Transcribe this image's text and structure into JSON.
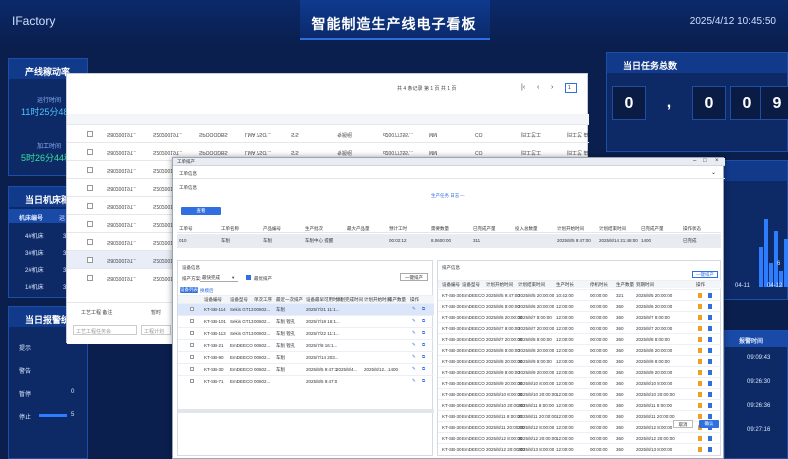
{
  "header": {
    "brand": "IFactory",
    "title": "智能制造生产线电子看板",
    "clock": "2025/4/12 10:45:50"
  },
  "left": {
    "rate_title": "产线稼动率",
    "run_label": "运行时间",
    "run_value": "11时25分48秒",
    "work_label": "加工时间",
    "work_value": "5时26分44秒",
    "machine_title": "当日机床稼动",
    "col1": "机床编号",
    "col2": "运",
    "rows": [
      {
        "id": "4#机床",
        "v": "3时"
      },
      {
        "id": "3#机床",
        "v": "3时"
      },
      {
        "id": "2#机床",
        "v": "3时"
      },
      {
        "id": "1#机床",
        "v": "3时"
      }
    ],
    "alarm_title": "当日报警统计",
    "alarm_rows": [
      {
        "k": "提示",
        "v": ""
      },
      {
        "k": "警告",
        "v": ""
      },
      {
        "k": "暂停",
        "v": "0"
      },
      {
        "k": "停止",
        "v": "5"
      }
    ]
  },
  "right": {
    "task_title": "当日任务总数",
    "digits": [
      "0",
      ",",
      "0",
      "0",
      "9"
    ],
    "output_title": "累计产量总数",
    "chart_value": "6",
    "chart_x": [
      "04-11",
      "04-12"
    ],
    "alarm_header": "报警时间",
    "alarm_times": [
      "09:09:43",
      "09:26:30",
      "09:26:36",
      "09:27:16"
    ],
    "chart_bars": [
      0.5,
      0.85,
      0.3,
      0.7,
      0.2,
      0.6
    ]
  },
  "back": {
    "pager": "共 4 条记录 第 1 页 共 1 页",
    "page_input": "1",
    "toolbar_btn": "筛选",
    "rows": [
      {
        "c1": "S8020019T...",
        "c2": "S2020019T...",
        "c3": "SPOOODBS",
        "c4": "LMA 7SO'...",
        "c5": "S'S",
        "c6": "专题组",
        "c7": "d20077155'...",
        "c8": "MM",
        "c9": "CO",
        "c10": "旧工艺工",
        "c11": "旧工艺 由"
      },
      {
        "c1": "S8020019T...",
        "c2": "S2020019T...",
        "c3": "SPOOODBS",
        "c4": "LMA 7SO'...",
        "c5": "S'S",
        "c6": "专题组",
        "c7": "d20077155'...",
        "c8": "MM",
        "c9": "CO",
        "c10": "旧工艺工",
        "c11": "旧工艺 由"
      },
      {
        "c1": "S8020019T...",
        "c2": "S2020019T...",
        "c3": "",
        "c4": "",
        "c5": "",
        "c6": "",
        "c7": "",
        "c8": "",
        "c9": "",
        "c10": "",
        "c11": ""
      },
      {
        "c1": "S8020019T...",
        "c2": "S2020019T...",
        "c3": "",
        "c4": "",
        "c5": "",
        "c6": "",
        "c7": "",
        "c8": "",
        "c9": "",
        "c10": "",
        "c11": ""
      },
      {
        "c1": "S8020019T...",
        "c2": "S2020019T...",
        "c3": "",
        "c4": "",
        "c5": "",
        "c6": "",
        "c7": "",
        "c8": "",
        "c9": "",
        "c10": "",
        "c11": ""
      },
      {
        "c1": "S8020019T...",
        "c2": "S2020019T...",
        "c3": "",
        "c4": "",
        "c5": "",
        "c6": "",
        "c7": "",
        "c8": "",
        "c9": "",
        "c10": "",
        "c11": ""
      },
      {
        "c1": "S8020019T...",
        "c2": "S2020019T...",
        "c3": "",
        "c4": "",
        "c5": "",
        "c6": "",
        "c7": "",
        "c8": "",
        "c9": "",
        "c10": "",
        "c11": ""
      },
      {
        "c1": "S8020019T...",
        "c2": "S2020019T...",
        "c3": "",
        "c4": "",
        "c5": "",
        "c6": "",
        "c7": "",
        "c8": "",
        "c9": "",
        "c10": "",
        "c11": ""
      },
      {
        "c1": "S8020019T...",
        "c2": "S2020019T...",
        "c3": "",
        "c4": "",
        "c5": "",
        "c6": "",
        "c7": "",
        "c8": "",
        "c9": "",
        "c10": "",
        "c11": ""
      }
    ],
    "footer_a": "工艺工程任务会",
    "footer_b": "工程计划",
    "footer_c": "工艺工程 备注",
    "footer_d": "暂时"
  },
  "modal": {
    "title": "工单排产",
    "tab": "工单信息",
    "sec1": "工单信息",
    "sec1_btn": "生产任务 日志",
    "btn_view": "查看",
    "wo_headers": [
      "工单号",
      "工单名称",
      "产品编号",
      "生产批次",
      "最大产品量",
      "预计工时",
      "需要数量",
      "已完成产量",
      "投入总数量",
      "计划开始时间",
      "计划结束时间",
      "已完成产量",
      "操作状态"
    ],
    "wo_row": [
      "010",
      "车削",
      "车削",
      "车削中心 提醒",
      "",
      "00:02:12",
      "8.0600:00",
      "311",
      "",
      "2025/8/5 9:47:00",
      "2025/8/14 21:48:00",
      "1400",
      "已完成"
    ],
    "dev_title": "设备信息",
    "filter_label": "排产方案:",
    "filter_value": "最快完成",
    "filter_check": "最优排产",
    "dev_btn": "一键排产",
    "dev_tabs": [
      "设备列表",
      "换模后"
    ],
    "dev_headers": [
      "",
      "设备编号",
      "设备型号",
      "单次工序",
      "最近一次排产",
      "设备最早可用时间",
      "计划完成时间",
      "计划开始时间",
      "排产数量",
      "操作"
    ],
    "dev_rows": [
      {
        "a": "KT-SB-114",
        "b": "Sekis GT13",
        "c": "00602...",
        "d": "车削",
        "e": "2025/7/21 11:1...",
        "f": "",
        "g": "",
        "h": ""
      },
      {
        "a": "KT-SB-101",
        "b": "Sekis GT13",
        "c": "00602...",
        "d": "车削 镗孔",
        "e": "2025/7/18 16:1...",
        "f": "",
        "g": "",
        "h": ""
      },
      {
        "a": "KT-SB-113",
        "b": "Sekis GT13",
        "c": "00602...",
        "d": "车削 镗孔",
        "e": "2025/7/22 11:1...",
        "f": "",
        "g": "",
        "h": ""
      },
      {
        "a": "KT-SB-21",
        "b": "EmDEECO",
        "c": "00602...",
        "d": "车削 镗孔",
        "e": "2025/7/8 16:1...",
        "f": "",
        "g": "",
        "h": ""
      },
      {
        "a": "KT-SB-90",
        "b": "EmDEECO",
        "c": "00602...",
        "d": "车削",
        "e": "2025/7/14 203...",
        "f": "",
        "g": "",
        "h": ""
      },
      {
        "a": "KT-SB-30",
        "b": "EmDEECO",
        "c": "00602...",
        "d": "车削",
        "e": "2025/8/5 9:47:1",
        "f": "2025/8/4...",
        "g": "2025/8/12...",
        "h": "1400"
      },
      {
        "a": "KT-SB-71",
        "b": "EmDEECO",
        "c": "00602...",
        "d": "",
        "e": "2025/8/5 9:47:0",
        "f": "",
        "g": "",
        "h": ""
      }
    ],
    "sched_title": "排产信息",
    "sched_btn": "一键排产",
    "sched_headers": [
      "设备编号",
      "设备型号",
      "计划开始时间",
      "计划结束时间",
      "生产时长",
      "停机时长",
      "生产数量",
      "到期时间",
      "操作"
    ],
    "sched_rows": [
      {
        "a": "KT-SB-30",
        "b": "EmDEECO",
        "c": "2025/8/5 9:47:00",
        "d": "2025/8/5 20:00:00",
        "e": "10:42:00",
        "f": "00:00:00",
        "g": "321",
        "h": "2025/8/5 20:00:00"
      },
      {
        "a": "KT-SB-30",
        "b": "EmDEECO",
        "c": "2025/8/6 8:00:00",
        "d": "2025/8/6 20:00:00",
        "e": "12:00:00",
        "f": "00:00:00",
        "g": "360",
        "h": "2025/8/6 20:00:00"
      },
      {
        "a": "KT-SB-30",
        "b": "EmDEECO",
        "c": "2025/8/6 20:00:00",
        "d": "2025/8/7 8:00:00",
        "e": "12:00:00",
        "f": "00:00:00",
        "g": "360",
        "h": "2025/8/7 8:00:00"
      },
      {
        "a": "KT-SB-30",
        "b": "EmDEECO",
        "c": "2025/8/7 8:00:00",
        "d": "2025/8/7 20:00:00",
        "e": "12:00:00",
        "f": "00:00:00",
        "g": "360",
        "h": "2025/8/7 20:00:00"
      },
      {
        "a": "KT-SB-30",
        "b": "EmDEECO",
        "c": "2025/8/7 20:00:00",
        "d": "2025/8/8 8:00:00",
        "e": "12:00:00",
        "f": "00:00:00",
        "g": "360",
        "h": "2025/8/8 8:00:00"
      },
      {
        "a": "KT-SB-30",
        "b": "EmDEECO",
        "c": "2025/8/8 8:00:00",
        "d": "2025/8/8 20:00:00",
        "e": "12:00:00",
        "f": "00:00:00",
        "g": "360",
        "h": "2025/8/8 20:00:00"
      },
      {
        "a": "KT-SB-30",
        "b": "EmDEECO",
        "c": "2025/8/8 20:00:00",
        "d": "2025/8/9 8:00:00",
        "e": "12:00:00",
        "f": "00:00:00",
        "g": "360",
        "h": "2025/8/9 8:00:00"
      },
      {
        "a": "KT-SB-30",
        "b": "EmDEECO",
        "c": "2025/8/9 8:00:00",
        "d": "2025/8/9 20:00:00",
        "e": "12:00:00",
        "f": "00:00:00",
        "g": "360",
        "h": "2025/8/9 20:00:00"
      },
      {
        "a": "KT-SB-30",
        "b": "EmDEECO",
        "c": "2025/8/9 20:00:00",
        "d": "2025/8/10 8:00:00",
        "e": "12:00:00",
        "f": "00:00:00",
        "g": "360",
        "h": "2025/8/10 8:00:00"
      },
      {
        "a": "KT-SB-30",
        "b": "EmDEECO",
        "c": "2025/8/10 8:00:00",
        "d": "2025/8/10 20:00:00",
        "e": "12:00:00",
        "f": "00:00:00",
        "g": "360",
        "h": "2025/8/10 20:00:00"
      },
      {
        "a": "KT-SB-30",
        "b": "EmDEECO",
        "c": "2025/8/10 20:00:00",
        "d": "2025/8/11 8:00:00",
        "e": "12:00:00",
        "f": "00:00:00",
        "g": "360",
        "h": "2025/8/11 8:00:00"
      },
      {
        "a": "KT-SB-30",
        "b": "EmDEECO",
        "c": "2025/8/11 8:00:00",
        "d": "2025/8/11 20:00:00",
        "e": "12:00:00",
        "f": "00:00:00",
        "g": "360",
        "h": "2025/8/11 20:00:00"
      },
      {
        "a": "KT-SB-30",
        "b": "EmDEECO",
        "c": "2025/8/11 20:00:00",
        "d": "2025/8/12 8:00:00",
        "e": "12:00:00",
        "f": "00:00:00",
        "g": "360",
        "h": "2025/8/12 8:00:00"
      },
      {
        "a": "KT-SB-30",
        "b": "EmDEECO",
        "c": "2025/8/12 8:00:00",
        "d": "2025/8/12 20:00:00",
        "e": "12:00:00",
        "f": "00:00:00",
        "g": "360",
        "h": "2025/8/12 20:00:00"
      },
      {
        "a": "KT-SB-30",
        "b": "EmDEECO",
        "c": "2025/8/12 20:00:00",
        "d": "2025/8/13 8:00:00",
        "e": "12:00:00",
        "f": "00:00:00",
        "g": "360",
        "h": "2025/8/13 8:00:00"
      }
    ],
    "cancel": "取消",
    "confirm": "确认"
  }
}
